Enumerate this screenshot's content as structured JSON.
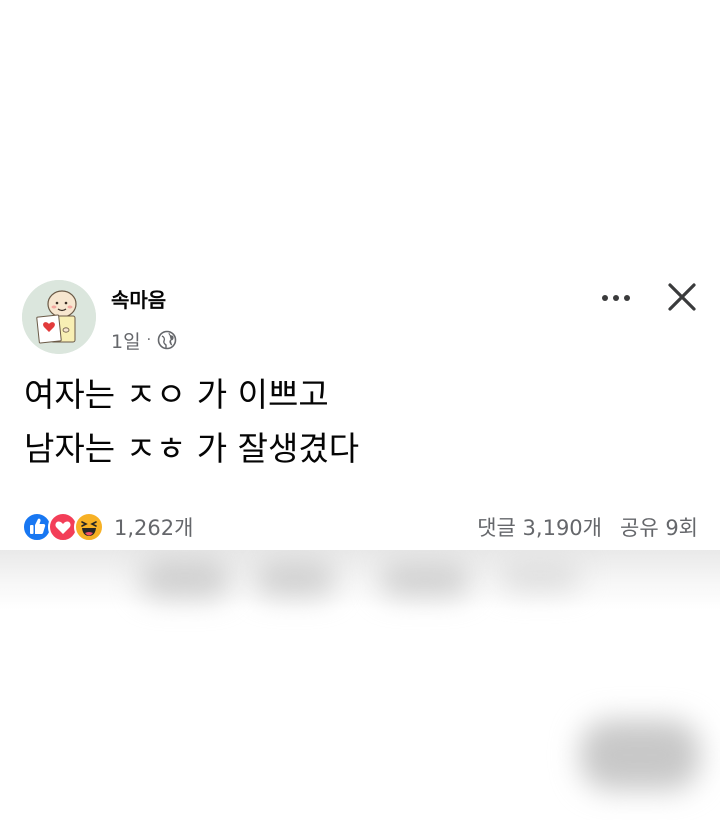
{
  "post": {
    "author": "속마음",
    "time": "1일",
    "separator": "·",
    "privacy_icon": "globe-icon",
    "text_lines": [
      "여자는 ㅈㅇ 가 이쁘고",
      "남자는 ㅈㅎ 가 잘생겼다"
    ],
    "reaction_icons": [
      "like-icon",
      "love-icon",
      "haha-icon"
    ],
    "reaction_count": "1,262개",
    "comments": "댓글 3,190개",
    "shares": "공유 9회"
  },
  "colors": {
    "text": "#050505",
    "secondary": "#65676b",
    "like": "#1877f2",
    "love": "#f33e58",
    "haha": "#f7b125"
  }
}
